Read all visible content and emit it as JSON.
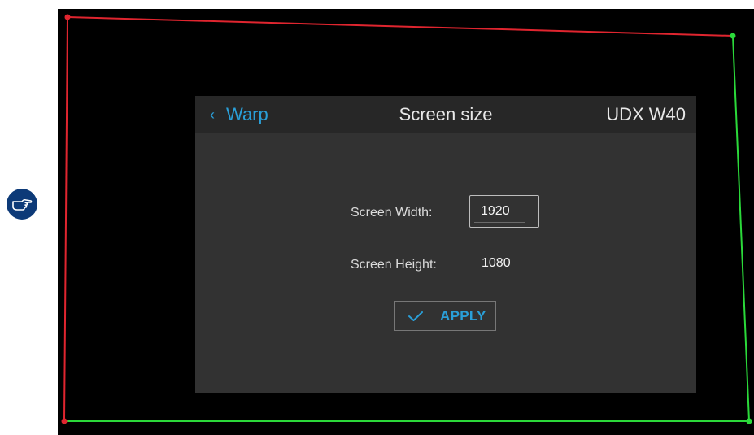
{
  "colors": {
    "background": "#000000",
    "dialog_body": "#323232",
    "dialog_header": "#272727",
    "accent": "#2a9fd8",
    "warp_edge_top_left": "#e0252f",
    "warp_edge_bottom_right": "#2bd93a",
    "note_icon": "#0d3a78"
  },
  "note": {
    "icon": "pointing-hand-icon"
  },
  "header": {
    "back_label": "Warp",
    "back_icon": "chevron-left-icon",
    "title": "Screen size",
    "model": "UDX W40"
  },
  "form": {
    "width_label": "Screen Width:",
    "width_value": "1920",
    "height_label": "Screen Height:",
    "height_value": "1080"
  },
  "apply": {
    "icon": "checkmark-icon",
    "label": "APPLY"
  }
}
